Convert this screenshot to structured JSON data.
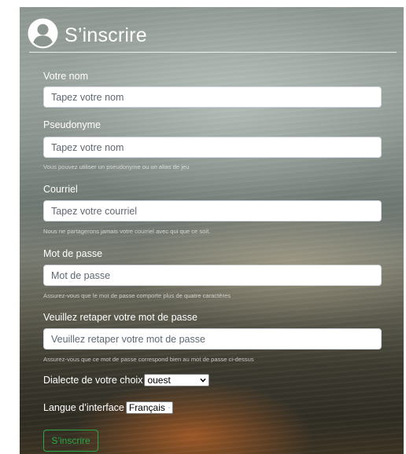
{
  "header": {
    "title": "S’inscrire"
  },
  "fields": [
    {
      "label": "Votre nom",
      "placeholder": "Tapez votre nom",
      "help": ""
    },
    {
      "label": "Pseudonyme",
      "placeholder": "Tapez votre nom",
      "help": "Vous pouvez utiliser un pseudonyme ou un alias de jeu"
    },
    {
      "label": "Courriel",
      "placeholder": "Tapez votre courriel",
      "help": "Nous ne partagerons jamais votre courriel avec qui que ce soit."
    },
    {
      "label": "Mot de passe",
      "placeholder": "Mot de passe",
      "help": "Assurez-vous que le mot de passe comporte plus de quatre caractères"
    },
    {
      "label": "Veuillez retaper votre mot de passe",
      "placeholder": "Veuillez retaper votre mot de passe",
      "help": "Assurez-vous que ce mot de passe correspond bien au mot de passe ci-dessus"
    }
  ],
  "dialect": {
    "label": "Dialecte de votre choix",
    "selected": "ouest"
  },
  "language": {
    "label": "Langue d’interface",
    "selected": "Français"
  },
  "submit_label": "S’inscrire"
}
